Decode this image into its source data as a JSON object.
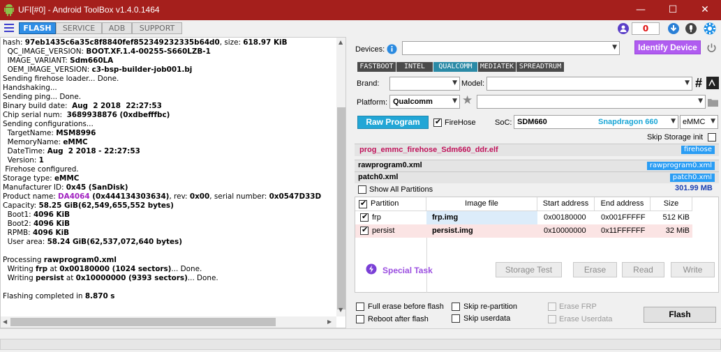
{
  "window": {
    "title": "UFI[#0] - Android ToolBox v1.4.0.1464",
    "min": "—",
    "max": "☐",
    "close": "✕"
  },
  "tabs": [
    "FLASH",
    "SERVICE",
    "ADB",
    "SUPPORT"
  ],
  "topbar": {
    "counter": "0"
  },
  "log": [
    [
      [
        "hash: ",
        ""
      ],
      [
        "97eb1435c6a35c8f8840fef852349232335b64d0",
        "b"
      ],
      [
        ", size: ",
        ""
      ],
      [
        "618.97 KiB",
        "b"
      ]
    ],
    [
      [
        "  QC_IMAGE_VERSION: ",
        ""
      ],
      [
        "BOOT.XF.1.4-00255-S660LZB-1",
        "b"
      ]
    ],
    [
      [
        "  IMAGE_VARIANT: ",
        ""
      ],
      [
        "Sdm660LA",
        "b"
      ]
    ],
    [
      [
        "  OEM_IMAGE_VERSION: ",
        ""
      ],
      [
        "c3-bsp-builder-job001.bj",
        "b"
      ]
    ],
    [
      [
        "Sending firehose loader... Done.",
        ""
      ]
    ],
    [
      [
        "Handshaking...",
        ""
      ]
    ],
    [
      [
        "Sending ping... Done.",
        ""
      ]
    ],
    [
      [
        "Binary build date:  ",
        ""
      ],
      [
        "Aug  2 2018  22:27:53",
        "b"
      ]
    ],
    [
      [
        "Chip serial num:  ",
        ""
      ],
      [
        "3689938876 (0xdbefffbc)",
        "b"
      ]
    ],
    [
      [
        "Sending configurations...",
        ""
      ]
    ],
    [
      [
        "  TargetName: ",
        ""
      ],
      [
        "MSM8996",
        "b"
      ]
    ],
    [
      [
        "  MemoryName: ",
        ""
      ],
      [
        "eMMC",
        "b"
      ]
    ],
    [
      [
        "  DateTime: ",
        ""
      ],
      [
        "Aug  2 2018 - 22:27:53",
        "b"
      ]
    ],
    [
      [
        "  Version: ",
        ""
      ],
      [
        "1",
        "b"
      ]
    ],
    [
      [
        " Firehose configured.",
        ""
      ]
    ],
    [
      [
        "Storage type: ",
        ""
      ],
      [
        "eMMC",
        "b"
      ]
    ],
    [
      [
        "Manufacturer ID: ",
        ""
      ],
      [
        "0x45 (SanDisk)",
        "b"
      ]
    ],
    [
      [
        "Product name: ",
        ""
      ],
      [
        "DA4064",
        "p"
      ],
      [
        " (0x444134303634)",
        "b"
      ],
      [
        ", rev: ",
        ""
      ],
      [
        "0x00",
        "b"
      ],
      [
        ", serial number: ",
        ""
      ],
      [
        "0x0547D33D",
        "b"
      ]
    ],
    [
      [
        "Capacity: ",
        ""
      ],
      [
        "58.25 GiB(62,549,655,552 bytes)",
        "b"
      ]
    ],
    [
      [
        "  Boot1: ",
        ""
      ],
      [
        "4096 KiB",
        "b"
      ]
    ],
    [
      [
        "  Boot2: ",
        ""
      ],
      [
        "4096 KiB",
        "b"
      ]
    ],
    [
      [
        "  RPMB: ",
        ""
      ],
      [
        "4096 KiB",
        "b"
      ]
    ],
    [
      [
        "  User area: ",
        ""
      ],
      [
        "58.24 GiB(62,537,072,640 bytes)",
        "b"
      ]
    ],
    [
      [
        "",
        ""
      ]
    ],
    [
      [
        "Processing ",
        ""
      ],
      [
        "rawprogram0.xml",
        "b"
      ]
    ],
    [
      [
        "  Writing ",
        ""
      ],
      [
        "frp",
        "b"
      ],
      [
        " at ",
        ""
      ],
      [
        "0x00180000 (1024 sectors)",
        "b"
      ],
      [
        "... Done.",
        ""
      ]
    ],
    [
      [
        "  Writing ",
        ""
      ],
      [
        "persist",
        "b"
      ],
      [
        " at ",
        ""
      ],
      [
        "0x10000000 (9393 sectors)",
        "b"
      ],
      [
        "... Done.",
        ""
      ]
    ],
    [
      [
        "",
        ""
      ]
    ],
    [
      [
        "Flashing completed in ",
        ""
      ],
      [
        "8.870 s",
        "b"
      ]
    ]
  ],
  "right": {
    "devices_label": "Devices:",
    "devices_value": "",
    "identify_label": "Identify Device",
    "chips": [
      "FASTBOOT",
      "INTEL",
      "QUALCOMM",
      "MEDIATEK",
      "SPREADTRUM"
    ],
    "brand_label": "Brand:",
    "model_label": "Model:",
    "platform_label": "Platform:",
    "platform_value": "Qualcomm",
    "raw_program_label": "Raw Program",
    "firehose_label": "FireHose",
    "soc_label": "SoC:",
    "soc_value": "SDM660",
    "soc_name": "Snapdragon 660",
    "mem_value": "eMMC",
    "skip_storage_label": "Skip Storage init",
    "firehose_file": "prog_emmc_firehose_Sdm660_ddr.elf",
    "firehose_tag": "firehose",
    "rawprogram_file": "rawprogram0.xml",
    "rawprogram_tag": "rawprogram0.xml",
    "patch_file": "patch0.xml",
    "patch_tag": "patch0.xml",
    "show_all_label": "Show All Partitions",
    "total_size": "301.99 MB",
    "columns": [
      "Partition",
      "Image file",
      "Start address",
      "End address",
      "Size"
    ],
    "partitions": [
      {
        "name": "frp",
        "image": "frp.img",
        "start": "0x00180000",
        "end": "0x001FFFFF",
        "size": "512 KiB"
      },
      {
        "name": "persist",
        "image": "persist.img",
        "start": "0x10000000",
        "end": "0x11FFFFFF",
        "size": "32 MiB"
      }
    ],
    "special_task_label": "Special Task",
    "storage_test_label": "Storage Test",
    "erase_label": "Erase",
    "read_label": "Read",
    "write_label": "Write",
    "full_erase_label": "Full erase before flash",
    "skip_repartition_label": "Skip re-partition",
    "erase_frp_label": "Erase FRP",
    "reboot_after_label": "Reboot after flash",
    "skip_userdata_label": "Skip userdata",
    "erase_userdata_label": "Erase Userdata",
    "flash_label": "Flash"
  },
  "colors": {
    "titlebar": "#a51f1c",
    "accent": "#2f8ee6",
    "identify": "#b05cf0",
    "raw_program": "#22a6d6",
    "firehose_file": "#c0125a",
    "soc_name": "#1aa6d6"
  }
}
